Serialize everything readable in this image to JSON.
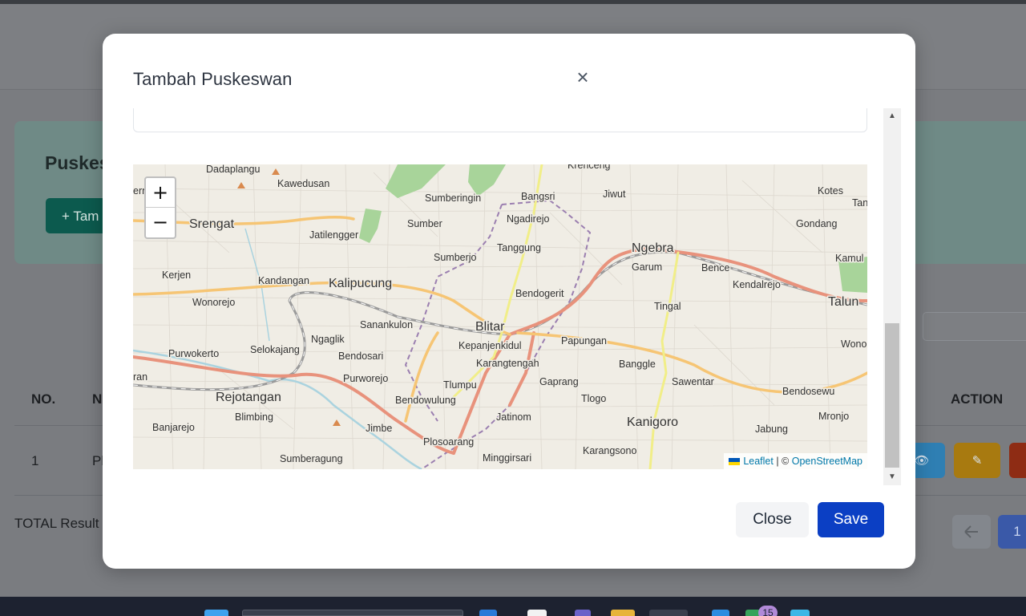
{
  "background": {
    "card_title": "Puskes",
    "add_button": "+ Tam",
    "table_headers": {
      "no": "NO.",
      "name": "N",
      "action": "ACTION"
    },
    "row": {
      "no": "1",
      "name": "Pl"
    },
    "total_label": "TOTAL Result",
    "pagination": {
      "prev_icon": "arrow-left",
      "page": "1"
    }
  },
  "modal": {
    "title": "Tambah Puskeswan",
    "close_icon": "×",
    "map": {
      "zoom_in": "+",
      "zoom_out": "−",
      "attribution": {
        "leaflet": "Leaflet",
        "separator": " | © ",
        "osm": "OpenStreetMap"
      },
      "place_labels": {
        "dadaplangu": "Dadaplangu",
        "kawedusan": "Kawedusan",
        "krenceng": "Krenceng",
        "sumberingin": "Sumberingin",
        "bangsri": "Bangsri",
        "jiwut": "Jiwut",
        "kotes": "Kotes",
        "tan": "Tan",
        "ern": "ern",
        "srengat": "Srengat",
        "jatilengger": "Jatilengger",
        "sumber": "Sumber",
        "ngadirejo": "Ngadirejo",
        "gondang": "Gondang",
        "tanggung": "Tanggung",
        "ngebra": "Ngebra",
        "garum": "Garum",
        "bence": "Bence",
        "kamul": "Kamul",
        "sumberjo": "Sumberjo",
        "kerjen": "Kerjen",
        "kandangan": "Kandangan",
        "kalipucung": "Kalipucung",
        "bendogerit": "Bendogerit",
        "kendalrejo": "Kendalrejo",
        "talun": "Talun",
        "wonorejo": "Wonorejo",
        "tingal": "Tingal",
        "sanankulon": "Sanankulon",
        "blitar": "Blitar",
        "ngaglik": "Ngaglik",
        "papungan": "Papungan",
        "kepanjenkidul": "Kepanjenkidul",
        "wono": "Wono",
        "purwokerto": "Purwokerto",
        "selokajang": "Selokajang",
        "bendosari": "Bendosari",
        "karangtengah": "Karangtengah",
        "banggle": "Banggle",
        "ran": "ran",
        "purworejo": "Purworejo",
        "gaprang": "Gaprang",
        "sawentar": "Sawentar",
        "tlumpu": "Tlumpu",
        "rejotangan": "Rejotangan",
        "bendowulung": "Bendowulung",
        "tlogo": "Tlogo",
        "bendosewu": "Bendosewu",
        "blimbing": "Blimbing",
        "jatinom": "Jatinom",
        "kanigoro": "Kanigoro",
        "mronjo": "Mronjo",
        "banjarejo": "Banjarejo",
        "jimbe": "Jimbe",
        "jabung": "Jabung",
        "plosoarang": "Plosoarang",
        "karangsono": "Karangsono",
        "sumberagung": "Sumberagung",
        "minggirsari": "Minggirsari"
      }
    },
    "buttons": {
      "close": "Close",
      "save": "Save"
    }
  },
  "taskbar": {
    "badge": "15"
  },
  "colors": {
    "save_button": "#0b3fc4",
    "close_button_bg": "#f3f4f6",
    "overlay": "#777b80",
    "attribution_link": "#0078a8",
    "road_primary": "#e8927c",
    "road_secondary": "#f6c574",
    "road_tertiary": "#f4f49a",
    "boundary": "#9b7fb0",
    "forest": "#9fcf8e"
  }
}
